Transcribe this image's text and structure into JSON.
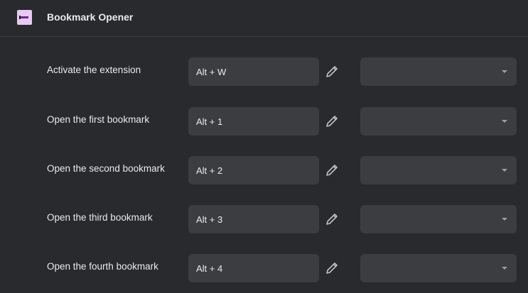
{
  "header": {
    "title": "Bookmark Opener",
    "icon": "extension-logo-icon"
  },
  "shortcuts": [
    {
      "label": "Activate the extension",
      "shortcut": "Alt + W",
      "scope": ""
    },
    {
      "label": "Open the first bookmark",
      "shortcut": "Alt + 1",
      "scope": ""
    },
    {
      "label": "Open the second bookmark",
      "shortcut": "Alt + 2",
      "scope": ""
    },
    {
      "label": "Open the third bookmark",
      "shortcut": "Alt + 3",
      "scope": ""
    },
    {
      "label": "Open the fourth bookmark",
      "shortcut": "Alt + 4",
      "scope": ""
    }
  ],
  "colors": {
    "background": "#292a2d",
    "field": "#3c3d40",
    "text": "#e8eaed",
    "icon_accent": "#e9c8f5"
  }
}
